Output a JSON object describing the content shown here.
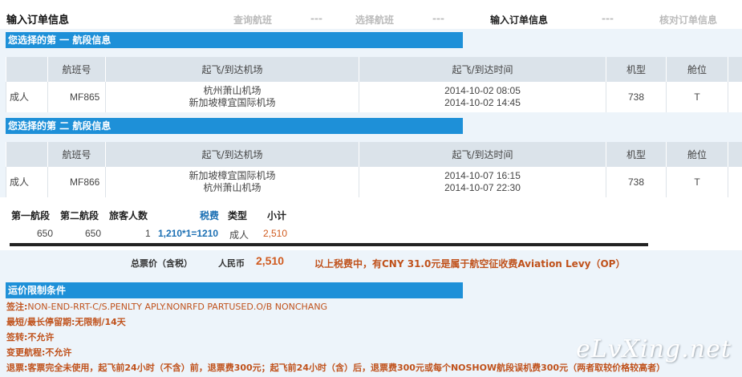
{
  "header": {
    "title": "输入订单信息",
    "steps": [
      {
        "label": "查询航班"
      },
      {
        "label": "---"
      },
      {
        "label": "选择航班"
      },
      {
        "label": "---"
      },
      {
        "label": "输入订单信息"
      },
      {
        "label": "---"
      },
      {
        "label": "核对订单信息"
      }
    ]
  },
  "segment1": {
    "title": "您选择的第 一 航段信息",
    "columns": [
      "",
      "航班号",
      "起飞/到达机场",
      "起飞/到达时间",
      "机型",
      "舱位"
    ],
    "row": {
      "passenger": "成人",
      "flight_no": "MF865",
      "dep_airport": "杭州萧山机场",
      "arr_airport": "新加坡樟宜国际机场",
      "dep_time": "2014-10-02 08:05",
      "arr_time": "2014-10-02 14:45",
      "aircraft": "738",
      "cabin": "T"
    }
  },
  "segment2": {
    "title": "您选择的第 二 航段信息",
    "columns": [
      "",
      "航班号",
      "起飞/到达机场",
      "起飞/到达时间",
      "机型",
      "舱位"
    ],
    "row": {
      "passenger": "成人",
      "flight_no": "MF866",
      "dep_airport": "新加坡樟宜国际机场",
      "arr_airport": "杭州萧山机场",
      "dep_time": "2014-10-07 16:15",
      "arr_time": "2014-10-07 22:30",
      "aircraft": "738",
      "cabin": "T"
    }
  },
  "summary": {
    "headers": {
      "seg1": "第一航段",
      "seg2": "第二航段",
      "pax": "旅客人数",
      "tax": "税费",
      "type": "类型",
      "subtotal": "小计"
    },
    "values": {
      "seg1": "650",
      "seg2": "650",
      "pax": "1",
      "tax": "1,210*1=1210",
      "type": "成人",
      "subtotal": "2,510"
    }
  },
  "total": {
    "label": "总票价（含税）",
    "currency": "人民币",
    "amount": "2,510",
    "note": "以上税费中，有CNY 31.0元是属于航空征收费Aviation Levy（OP）"
  },
  "rules": {
    "title": "运价限制条件",
    "items": [
      {
        "label": "签注:",
        "value": "NON-END-RRT-C/S.PENLTY APLY.NONRFD PARTUSED.O/B NONCHANG"
      },
      {
        "label": "最短/最长停留期:",
        "value": "无限制/14天"
      },
      {
        "label": "签转:",
        "value": "不允许"
      },
      {
        "label": "变更航程:",
        "value": "不允许"
      },
      {
        "label": "退票:",
        "value": "客票完全未使用，起飞前24小时（不含）前，退票费300元；起飞前24小时（含）后，退票费300元或每个NOSHOW航段误机费300元（两者取较价格较高者）"
      }
    ]
  },
  "watermark": "eLvXing.net",
  "colors": {
    "accent": "#1e90d8",
    "orange": "#d05a1e",
    "panel": "#edf4fa"
  }
}
